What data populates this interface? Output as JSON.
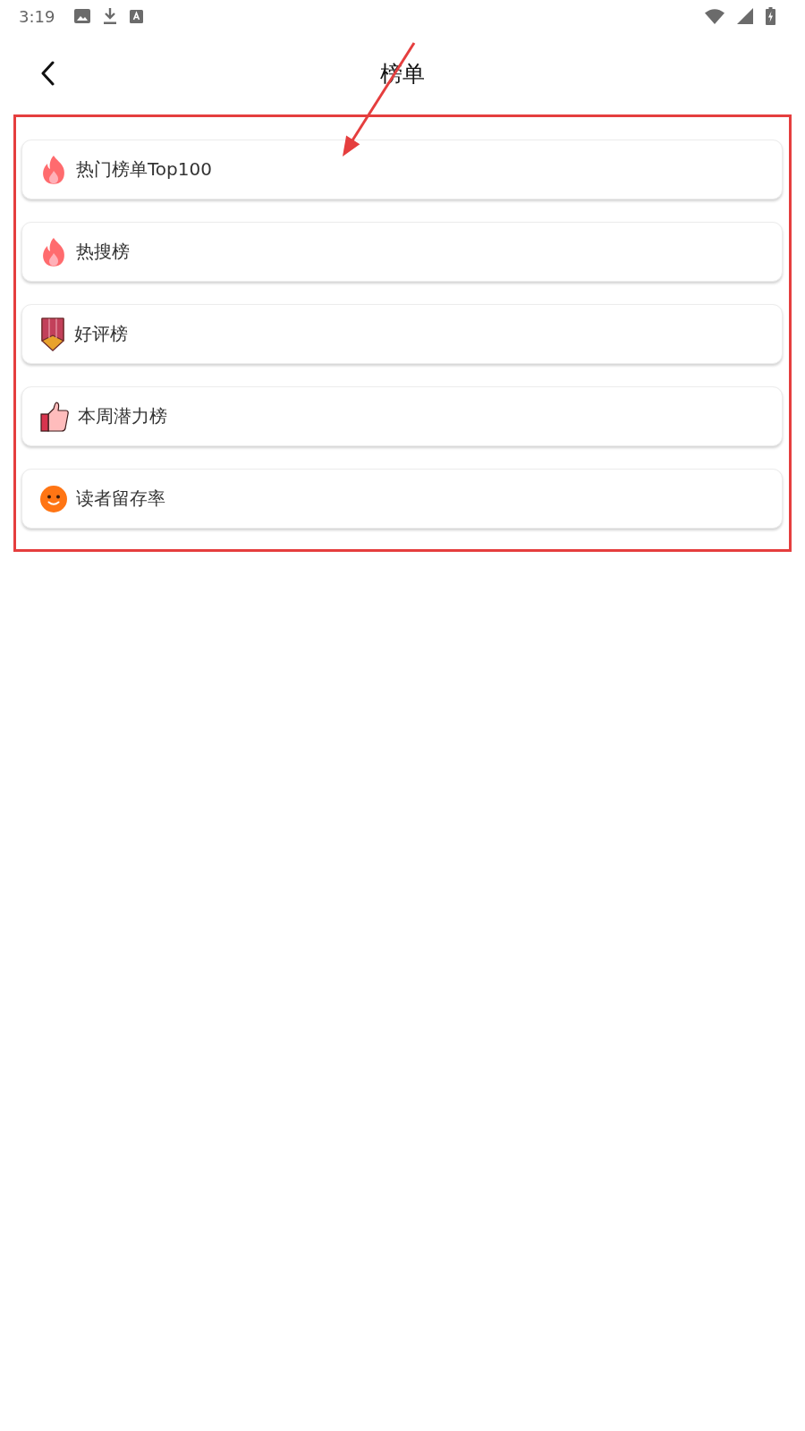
{
  "status_bar": {
    "time": "3:19"
  },
  "header": {
    "title": "榜单"
  },
  "rankings": [
    {
      "label": "热门榜单Top100",
      "kind": "flame"
    },
    {
      "label": "热搜榜",
      "kind": "flame"
    },
    {
      "label": "好评榜",
      "kind": "ribbon"
    },
    {
      "label": "本周潜力榜",
      "kind": "thumbs-up"
    },
    {
      "label": "读者留存率",
      "kind": "smiley"
    }
  ]
}
